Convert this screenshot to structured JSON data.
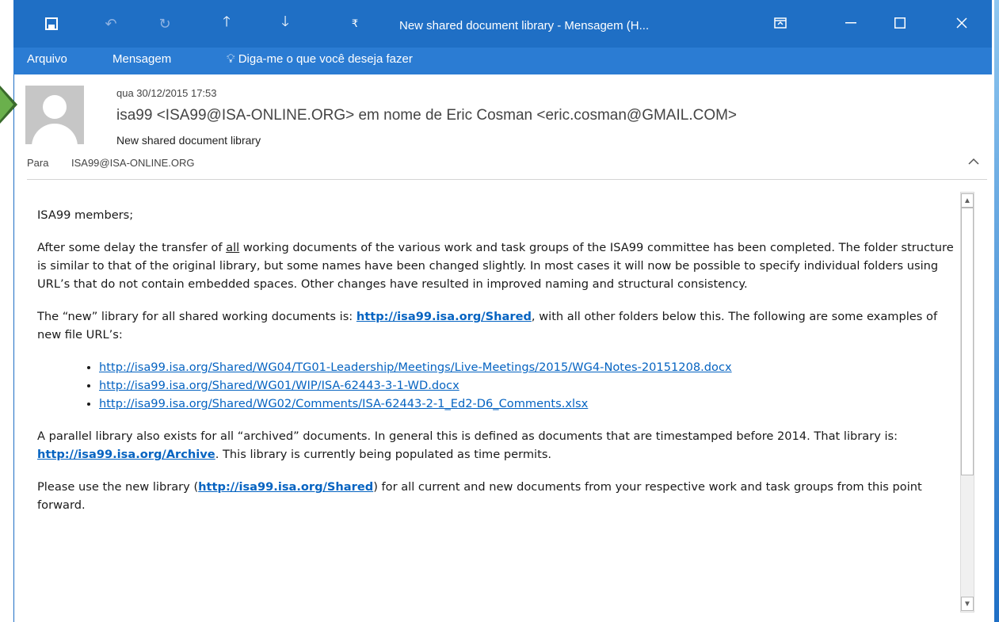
{
  "window": {
    "title": "New shared document library - Mensagem (H...",
    "quick_access": [
      "save-icon",
      "undo-icon",
      "redo-icon",
      "up-arrow-icon",
      "down-arrow-icon",
      "customize-icon"
    ],
    "controls": [
      "ribbon-display-icon",
      "minimize-icon",
      "maximize-icon",
      "close-icon"
    ]
  },
  "ribbon": {
    "tabs": [
      "Arquivo",
      "Mensagem"
    ],
    "tell_me": "Diga-me o que você deseja fazer"
  },
  "header": {
    "date": "qua 30/12/2015 17:53",
    "from": "isa99 <ISA99@ISA-ONLINE.ORG> em nome de Eric Cosman <eric.cosman@GMAIL.COM>",
    "subject": "New shared document library",
    "to_label": "Para",
    "to_value": "ISA99@ISA-ONLINE.ORG"
  },
  "body": {
    "greeting": "ISA99 members;",
    "p1_a": "After some delay the transfer of ",
    "p1_u": "all",
    "p1_b": " working documents of the various work and task groups of the ISA99 committee has been completed. The folder structure is similar to that of the original library, but some names have been changed slightly. In most cases it will now be possible to specify individual folders using URL’s that do not contain embedded spaces. Other changes have resulted in improved naming and structural consistency.",
    "p2_a": "The “new” library for all shared working documents is: ",
    "p2_link": "http://isa99.isa.org/Shared",
    "p2_b": ", with all other folders below this. The following are some examples of new file URL’s:",
    "links": [
      "http://isa99.isa.org/Shared/WG04/TG01-Leadership/Meetings/Live-Meetings/2015/WG4-Notes-20151208.docx",
      "http://isa99.isa.org/Shared/WG01/WIP/ISA-62443-3-1-WD.docx",
      "http://isa99.isa.org/Shared/WG02/Comments/ISA-62443-2-1_Ed2-D6_Comments.xlsx"
    ],
    "p3_a": "A parallel library also exists for all “archived” documents. In general this is defined as documents that are timestamped before 2014. That library is: ",
    "p3_link": "http://isa99.isa.org/Archive",
    "p3_b": ". This library is currently being populated as time permits.",
    "p4_a": "Please use the new library (",
    "p4_link": "http://isa99.isa.org/Shared",
    "p4_b": ") for all current and new documents from your respective work and task groups from this point forward."
  },
  "colors": {
    "titlebar": "#1f6fc5",
    "ribbon": "#2b7cd3",
    "link": "#0563c1"
  }
}
